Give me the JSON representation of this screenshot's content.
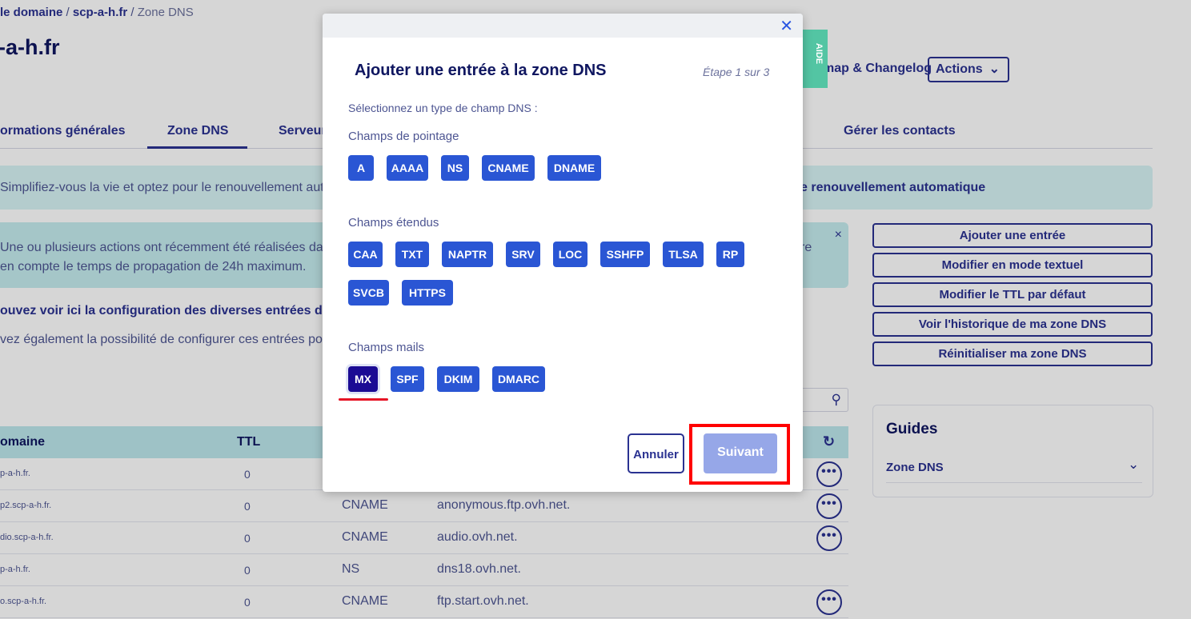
{
  "breadcrumb": {
    "item1": "le domaine",
    "sep1": " / ",
    "item2": "scp-a-h.fr",
    "sep2": " / ",
    "current": "Zone DNS"
  },
  "page_title": "-a-h.fr",
  "header": {
    "roadmap_link": "map & Changelog",
    "actions_label": "Actions",
    "actions_chevron": "⌄"
  },
  "tabs": [
    "ormations générales",
    "Zone DNS",
    "Serveur",
    "Gérer les contacts"
  ],
  "banner_renew": {
    "text": "Simplifiez-vous la vie et optez pour le renouvellement autom",
    "bold_text": "e renouvellement automatique"
  },
  "banner_info": {
    "line1": "Une ou plusieurs actions ont récemment été réalisées dans",
    "line2": "en compte le temps de propagation de 24h maximum.",
    "tail": "re",
    "close": "×"
  },
  "intro": {
    "line1": "ouvez voir ici la configuration des diverses entrées de vot",
    "line2": "vez également la possibilité de configurer ces entrées pour re"
  },
  "table": {
    "headers": {
      "domain": "omaine",
      "ttl": "TTL"
    },
    "rows": [
      {
        "domain": "p-a-h.fr.",
        "ttl": "0",
        "type": "",
        "target": ""
      },
      {
        "domain": "p2.scp-a-h.fr.",
        "ttl": "0",
        "type": "CNAME",
        "target": "anonymous.ftp.ovh.net."
      },
      {
        "domain": "dio.scp-a-h.fr.",
        "ttl": "0",
        "type": "CNAME",
        "target": "audio.ovh.net."
      },
      {
        "domain": "p-a-h.fr.",
        "ttl": "0",
        "type": "NS",
        "target": "dns18.ovh.net."
      },
      {
        "domain": "o.scp-a-h.fr.",
        "ttl": "0",
        "type": "CNAME",
        "target": "ftp.start.ovh.net."
      }
    ],
    "more_label": "•••"
  },
  "sidebar_actions": [
    "Ajouter une entrée",
    "Modifier en mode textuel",
    "Modifier le TTL par défaut",
    "Voir l'historique de ma zone DNS",
    "Réinitialiser ma zone DNS"
  ],
  "guides": {
    "title": "Guides",
    "item": "Zone DNS"
  },
  "aide_tab": "AIDE",
  "modal": {
    "title": "Ajouter une entrée à la zone DNS",
    "step": "Étape 1 sur 3",
    "prompt": "Sélectionnez un type de champ DNS :",
    "groups": [
      {
        "label": "Champs de pointage",
        "types": [
          "A",
          "AAAA",
          "NS",
          "CNAME",
          "DNAME"
        ]
      },
      {
        "label": "Champs étendus",
        "types": [
          "CAA",
          "TXT",
          "NAPTR",
          "SRV",
          "LOC",
          "SSHFP",
          "TLSA",
          "RP",
          "SVCB",
          "HTTPS"
        ]
      },
      {
        "label": "Champs mails",
        "types": [
          "MX",
          "SPF",
          "DKIM",
          "DMARC"
        ]
      }
    ],
    "selected_type": "MX",
    "cancel_label": "Annuler",
    "next_label": "Suivant"
  },
  "colors": {
    "primary": "#2a56d4",
    "selected": "#1b0b94",
    "next_disabled": "#96a7e8",
    "annotation_red": "#ff0000",
    "aide_green": "#53c5a3"
  }
}
